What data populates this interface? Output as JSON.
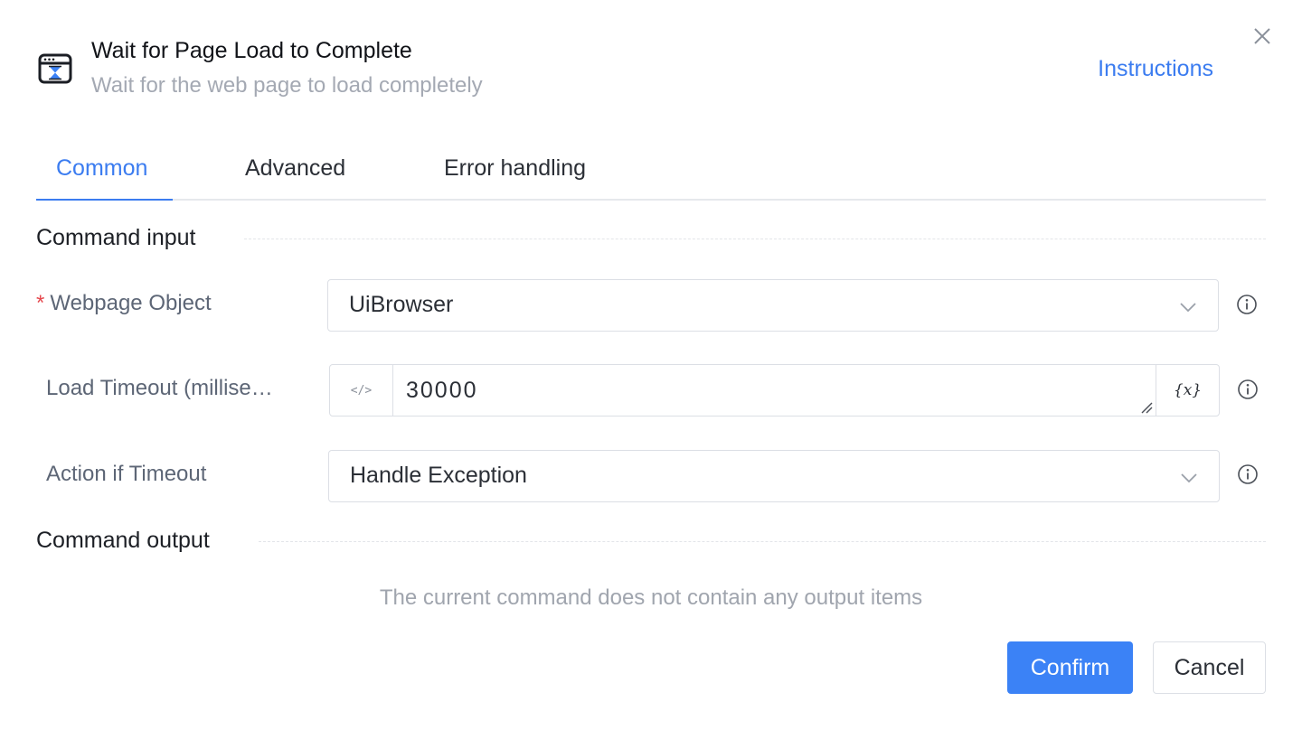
{
  "header": {
    "title": "Wait for Page Load to Complete",
    "subtitle": "Wait for the web page to load completely",
    "instructions_label": "Instructions",
    "icon": "browser-hourglass-icon",
    "close_icon": "close-icon"
  },
  "tabs": [
    {
      "label": "Common",
      "active": true
    },
    {
      "label": "Advanced",
      "active": false
    },
    {
      "label": "Error handling",
      "active": false
    }
  ],
  "sections": {
    "input_title": "Command input",
    "output_title": "Command output",
    "output_empty": "The current command does not contain any output items"
  },
  "fields": {
    "webpage_object": {
      "required_mark": "*",
      "label": "Webpage Object",
      "value": "UiBrowser"
    },
    "load_timeout": {
      "label": "Load Timeout (millise…",
      "value": "30000",
      "code_toggle": "</>",
      "variable_button": "{x}"
    },
    "action_if_timeout": {
      "label": "Action if Timeout",
      "value": "Handle Exception"
    }
  },
  "footer": {
    "confirm_label": "Confirm",
    "cancel_label": "Cancel"
  },
  "colors": {
    "accent": "#3b7cf0",
    "primary_button": "#3b82f6",
    "required": "#e5484d"
  }
}
